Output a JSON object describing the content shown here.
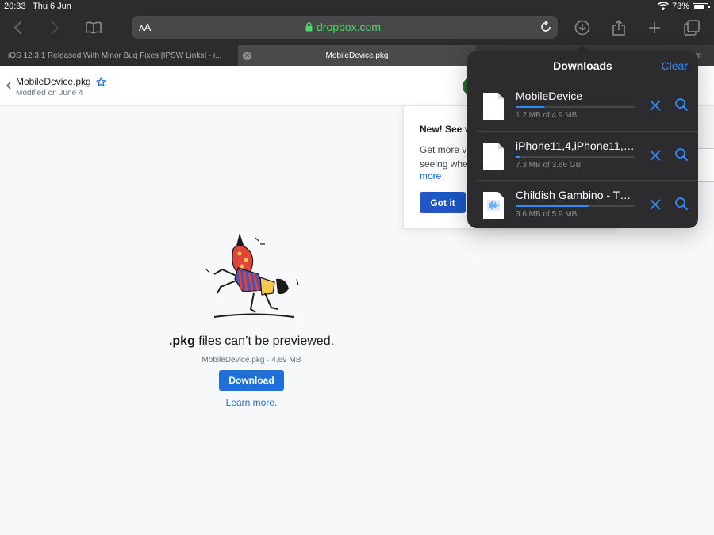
{
  "status_bar": {
    "time": "20:33",
    "date": "Thu 6 Jun",
    "battery": "73%"
  },
  "address_bar": {
    "text_size_label_small": "A",
    "text_size_label_big": "A",
    "url": "dropbox.com"
  },
  "tabs": [
    {
      "label": "iOS 12.3.1 Released With Minor Bug Fixes [IPSW Links] - i..."
    },
    {
      "label": "MobileDevice.pkg"
    },
    {
      "label": "m"
    }
  ],
  "page_header": {
    "file_name": "MobileDevice.pkg",
    "modified": "Modified on June 4"
  },
  "tooltip_card": {
    "title": "New! See v",
    "body": "Get more v\nseeing whe",
    "more_link": "more",
    "button": "Got it"
  },
  "preview": {
    "ext": ".pkg",
    "message": " files can’t be previewed.",
    "meta": "MobileDevice.pkg · 4.69 MB",
    "download_button": "Download",
    "learn_more": "Learn more."
  },
  "downloads": {
    "title": "Downloads",
    "clear": "Clear",
    "items": [
      {
        "name": "MobileDevice",
        "size": "1.2 MB of 4.9 MB",
        "progress": 0.24,
        "icon": "document-icon"
      },
      {
        "name": "iPhone11,4,iPhone11,6...",
        "size": "7.3 MB of 3.66 GB",
        "progress": 0.03,
        "icon": "document-icon"
      },
      {
        "name": "Childish Gambino - Th...",
        "size": "3.6 MB of 5.9 MB",
        "progress": 0.61,
        "icon": "audio-file-icon"
      }
    ]
  },
  "colors": {
    "accent": "#2f8cff",
    "url_green": "#4cd964",
    "dropbox_blue": "#1f6fd6"
  }
}
